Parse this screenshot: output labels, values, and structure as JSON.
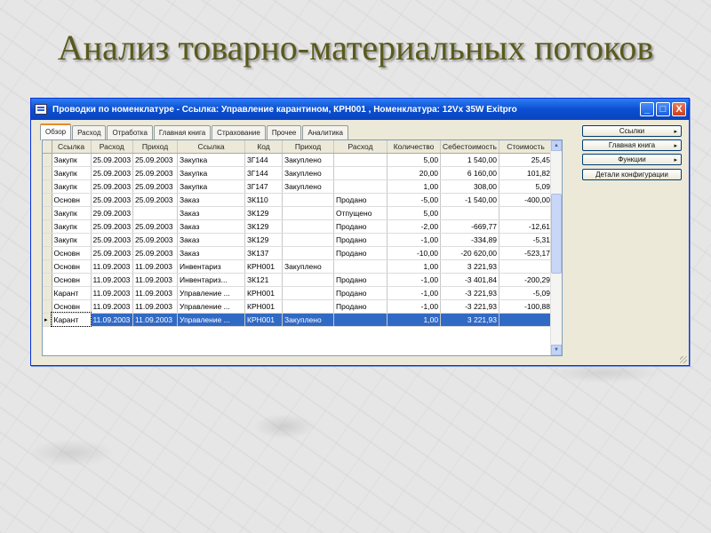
{
  "slide": {
    "title": "Анализ товарно-материальных потоков"
  },
  "window": {
    "title": "Проводки по номенклатуре - Ссылка: Управление карантином, КРН001 , Номенклатура: 12Vx 35W Exitpro",
    "controls": {
      "minimize": "_",
      "maximize": "□",
      "close": "X"
    }
  },
  "tabs": [
    "Обзор",
    "Расход",
    "Отработка",
    "Главная книга",
    "Страхование",
    "Прочее",
    "Аналитика"
  ],
  "side_buttons": [
    {
      "label": "Ссылки",
      "arrow": "▸"
    },
    {
      "label": "Главная книга",
      "arrow": "▸"
    },
    {
      "label": "Функции",
      "arrow": "▸"
    },
    {
      "label": "Детали конфигурации",
      "arrow": ""
    }
  ],
  "grid": {
    "columns": [
      "",
      "Ссылка",
      "Расход",
      "Приход",
      "Ссылка",
      "Код",
      "Приход",
      "Расход",
      "Количество",
      "Себестоимость",
      "Стоимость"
    ],
    "rows": [
      [
        "Закупк",
        "25.09.2003",
        "25.09.2003",
        "Закупка",
        "3Г144",
        "Закуплено",
        "",
        "5,00",
        "1 540,00",
        "25,45"
      ],
      [
        "Закупк",
        "25.09.2003",
        "25.09.2003",
        "Закупка",
        "3Г144",
        "Закуплено",
        "",
        "20,00",
        "6 160,00",
        "101,82"
      ],
      [
        "Закупк",
        "25.09.2003",
        "25.09.2003",
        "Закупка",
        "3Г147",
        "Закуплено",
        "",
        "1,00",
        "308,00",
        "5,09"
      ],
      [
        "Основн",
        "25.09.2003",
        "25.09.2003",
        "Заказ",
        "ЗК110",
        "",
        "Продано",
        "-5,00",
        "-1 540,00",
        "-400,00"
      ],
      [
        "Закупк",
        "29.09.2003",
        "",
        "Заказ",
        "ЗК129",
        "",
        "Отпущено",
        "5,00",
        "",
        ""
      ],
      [
        "Закупк",
        "25.09.2003",
        "25.09.2003",
        "Заказ",
        "ЗК129",
        "",
        "Продано",
        "-2,00",
        "-669,77",
        "-12,61"
      ],
      [
        "Закупк",
        "25.09.2003",
        "25.09.2003",
        "Заказ",
        "ЗК129",
        "",
        "Продано",
        "-1,00",
        "-334,89",
        "-5,31"
      ],
      [
        "Основн",
        "25.09.2003",
        "25.09.2003",
        "Заказ",
        "ЗК137",
        "",
        "Продано",
        "-10,00",
        "-20 620,00",
        "-523,17"
      ],
      [
        "Основн",
        "11.09.2003",
        "11.09.2003",
        "Инвентариз",
        "КРН001",
        "Закуплено",
        "",
        "1,00",
        "3 221,93",
        ""
      ],
      [
        "Основн",
        "11.09.2003",
        "11.09.2003",
        "Инвентариз...",
        "ЗК121",
        "",
        "Продано",
        "-1,00",
        "-3 401,84",
        "-200,29"
      ],
      [
        "Карант",
        "11.09.2003",
        "11.09.2003",
        "Управление ...",
        "КРН001",
        "",
        "Продано",
        "-1,00",
        "-3 221,93",
        "-5,09"
      ],
      [
        "Основн",
        "11.09.2003",
        "11.09.2003",
        "Управление ...",
        "КРН001",
        "",
        "Продано",
        "-1,00",
        "-3 221,93",
        "-100,88"
      ],
      [
        "Карант",
        "11.09.2003",
        "11.09.2003",
        "Управление ...",
        "КРН001",
        "Закуплено",
        "",
        "1,00",
        "3 221,93",
        ""
      ]
    ],
    "selected_row": 12,
    "row_marker": "▸"
  }
}
